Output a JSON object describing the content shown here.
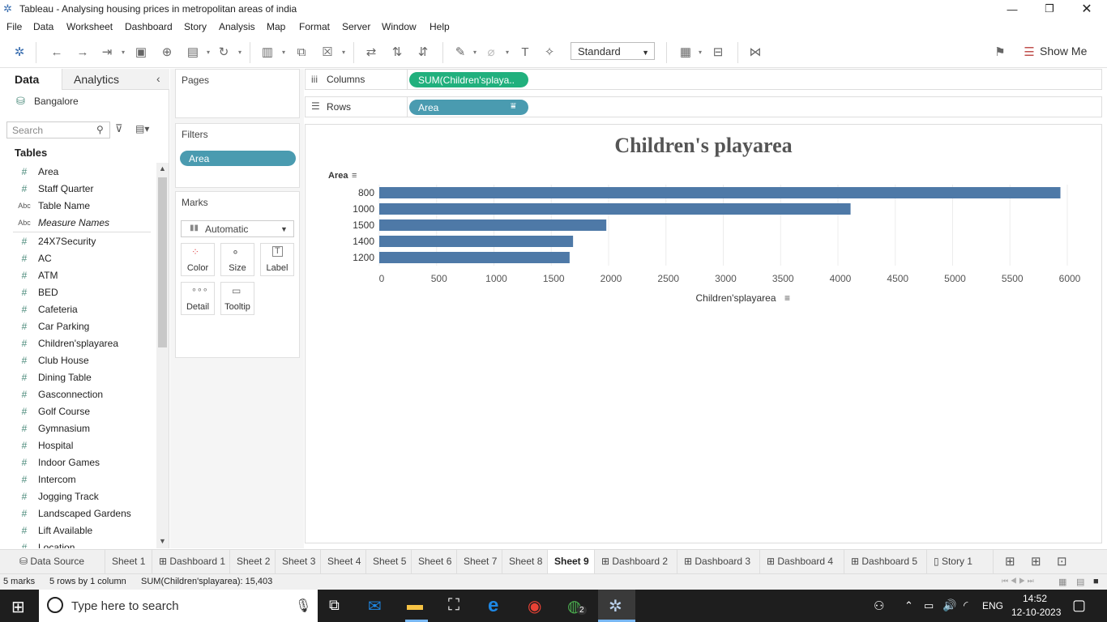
{
  "window": {
    "title": "Tableau - Analysing housing prices in metropolitan areas of india"
  },
  "menu": [
    "File",
    "Data",
    "Worksheet",
    "Dashboard",
    "Story",
    "Analysis",
    "Map",
    "Format",
    "Server",
    "Window",
    "Help"
  ],
  "toolbar": {
    "fit_select": "Standard",
    "show_me": "Show Me"
  },
  "left_panel": {
    "tabs": {
      "data": "Data",
      "analytics": "Analytics"
    },
    "datasource": "Bangalore",
    "search_placeholder": "Search",
    "tables_heading": "Tables",
    "fields_top": [
      {
        "icon": "#",
        "name": "Area"
      },
      {
        "icon": "#",
        "name": "Staff Quarter"
      },
      {
        "icon": "Abc",
        "name": "Table Name"
      },
      {
        "icon": "Abc",
        "name": "Measure Names"
      }
    ],
    "fields": [
      "24X7Security",
      "AC",
      "ATM",
      "BED",
      "Cafeteria",
      "Car Parking",
      "Children'splayarea",
      "Club House",
      "Dining Table",
      "Gasconnection",
      "Golf Course",
      "Gymnasium",
      "Hospital",
      "Indoor Games",
      "Intercom",
      "Jogging Track",
      "Landscaped Gardens",
      "Lift Available",
      "Location"
    ]
  },
  "cards": {
    "pages": "Pages",
    "filters": "Filters",
    "filter_pill": "Area",
    "marks": "Marks",
    "mark_type": "Automatic",
    "mark_buttons": [
      "Color",
      "Size",
      "Label",
      "Detail",
      "Tooltip"
    ]
  },
  "shelves": {
    "columns_label": "Columns",
    "columns_pill": "SUM(Children'splaya..",
    "rows_label": "Rows",
    "rows_pill": "Area"
  },
  "chart_data": {
    "type": "bar",
    "orientation": "horizontal",
    "title": "Children's playarea",
    "ylabel": "Area",
    "xlabel": "Children'splayarea",
    "categories": [
      "800",
      "1000",
      "1500",
      "1400",
      "1200"
    ],
    "values": [
      5940,
      4110,
      1980,
      1690,
      1660
    ],
    "xlim": [
      0,
      6000
    ],
    "xticks": [
      0,
      500,
      1000,
      1500,
      2000,
      2500,
      3000,
      3500,
      4000,
      4500,
      5000,
      5500,
      6000
    ],
    "bar_color": "#4e79a7",
    "grid": true
  },
  "sheet_tabs": [
    "Data Source",
    "Sheet 1",
    "Dashboard 1",
    "Sheet 2",
    "Sheet 3",
    "Sheet 4",
    "Sheet 5",
    "Sheet 6",
    "Sheet 7",
    "Sheet 8",
    "Sheet 9",
    "Dashboard 2",
    "Dashboard 3",
    "Dashboard 4",
    "Dashboard 5",
    "Story 1"
  ],
  "active_tab": "Sheet 9",
  "status": {
    "marks": "5 marks",
    "rows": "5 rows by 1 column",
    "sum": "SUM(Children'splayarea): 15,403"
  },
  "taskbar": {
    "search_placeholder": "Type here to search",
    "lang": "ENG",
    "time": "14:52",
    "date": "12-10-2023",
    "badge": "2"
  },
  "colors": {
    "accent_teal": "#4a9bb0",
    "measure_green": "#21b07d",
    "bar": "#4e79a7"
  }
}
